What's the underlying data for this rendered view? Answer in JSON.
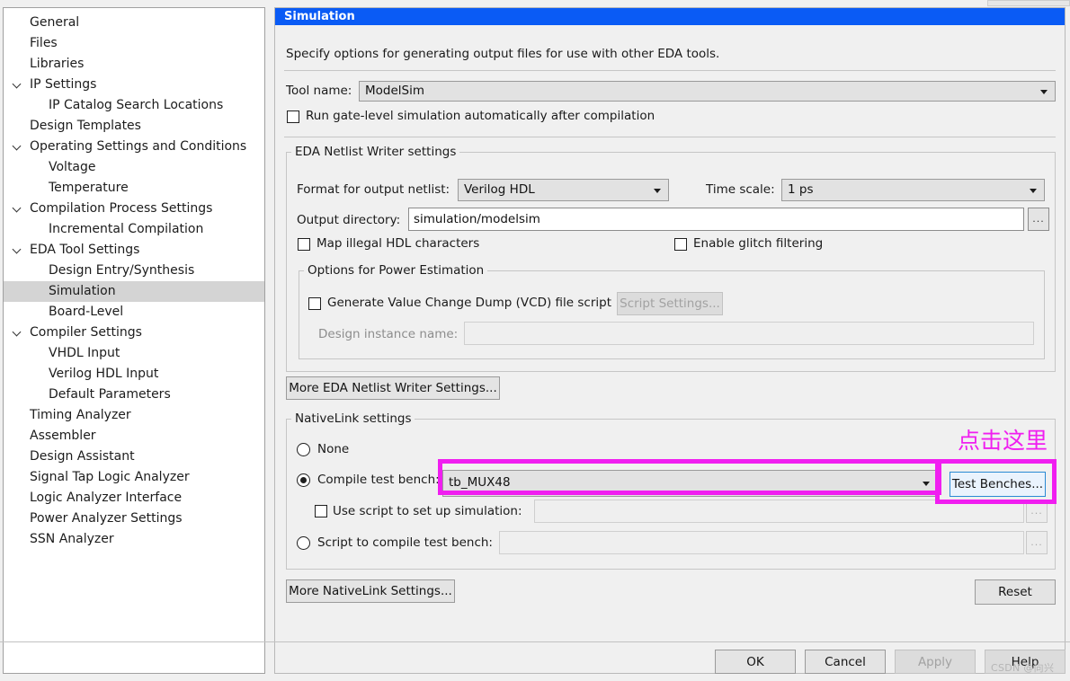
{
  "window": {
    "panel_title": "Simulation",
    "description": "Specify options for generating output files for use with other EDA tools."
  },
  "sidebar": {
    "items": [
      {
        "label": "General",
        "indent": 0,
        "expander": false,
        "selected": false
      },
      {
        "label": "Files",
        "indent": 0,
        "expander": false,
        "selected": false
      },
      {
        "label": "Libraries",
        "indent": 0,
        "expander": false,
        "selected": false
      },
      {
        "label": "IP Settings",
        "indent": 0,
        "expander": true,
        "selected": false
      },
      {
        "label": "IP Catalog Search Locations",
        "indent": 1,
        "expander": false,
        "selected": false
      },
      {
        "label": "Design Templates",
        "indent": 0,
        "expander": false,
        "selected": false
      },
      {
        "label": "Operating Settings and Conditions",
        "indent": 0,
        "expander": true,
        "selected": false
      },
      {
        "label": "Voltage",
        "indent": 1,
        "expander": false,
        "selected": false
      },
      {
        "label": "Temperature",
        "indent": 1,
        "expander": false,
        "selected": false
      },
      {
        "label": "Compilation Process Settings",
        "indent": 0,
        "expander": true,
        "selected": false
      },
      {
        "label": "Incremental Compilation",
        "indent": 1,
        "expander": false,
        "selected": false
      },
      {
        "label": "EDA Tool Settings",
        "indent": 0,
        "expander": true,
        "selected": false
      },
      {
        "label": "Design Entry/Synthesis",
        "indent": 1,
        "expander": false,
        "selected": false
      },
      {
        "label": "Simulation",
        "indent": 1,
        "expander": false,
        "selected": true
      },
      {
        "label": "Board-Level",
        "indent": 1,
        "expander": false,
        "selected": false
      },
      {
        "label": "Compiler Settings",
        "indent": 0,
        "expander": true,
        "selected": false
      },
      {
        "label": "VHDL Input",
        "indent": 1,
        "expander": false,
        "selected": false
      },
      {
        "label": "Verilog HDL Input",
        "indent": 1,
        "expander": false,
        "selected": false
      },
      {
        "label": "Default Parameters",
        "indent": 1,
        "expander": false,
        "selected": false
      },
      {
        "label": "Timing Analyzer",
        "indent": 0,
        "expander": false,
        "selected": false
      },
      {
        "label": "Assembler",
        "indent": 0,
        "expander": false,
        "selected": false
      },
      {
        "label": "Design Assistant",
        "indent": 0,
        "expander": false,
        "selected": false
      },
      {
        "label": "Signal Tap Logic Analyzer",
        "indent": 0,
        "expander": false,
        "selected": false
      },
      {
        "label": "Logic Analyzer Interface",
        "indent": 0,
        "expander": false,
        "selected": false
      },
      {
        "label": "Power Analyzer Settings",
        "indent": 0,
        "expander": false,
        "selected": false
      },
      {
        "label": "SSN Analyzer",
        "indent": 0,
        "expander": false,
        "selected": false
      }
    ]
  },
  "tool": {
    "label": "Tool name:",
    "value": "ModelSim"
  },
  "run_gate_level": {
    "label": "Run gate-level simulation automatically after compilation",
    "checked": false
  },
  "netlist": {
    "group_title": "EDA Netlist Writer settings",
    "format_label": "Format for output netlist:",
    "format_value": "Verilog HDL",
    "timescale_label": "Time scale:",
    "timescale_value": "1 ps",
    "output_dir_label": "Output directory:",
    "output_dir_value": "simulation/modelsim",
    "browse_label": "...",
    "map_illegal_label": "Map illegal HDL characters",
    "map_illegal_checked": false,
    "glitch_label": "Enable glitch filtering",
    "glitch_checked": false
  },
  "power": {
    "group_title": "Options for Power Estimation",
    "vcd_label": "Generate Value Change Dump (VCD) file script",
    "vcd_checked": false,
    "script_settings_label": "Script Settings...",
    "instance_label": "Design instance name:",
    "instance_value": ""
  },
  "more_netlist_btn": "More EDA Netlist Writer Settings...",
  "nativelink": {
    "group_title": "NativeLink settings",
    "none_label": "None",
    "none_selected": false,
    "compile_tb_label": "Compile test bench:",
    "compile_tb_selected": true,
    "compile_tb_value": "tb_MUX48",
    "test_benches_btn": "Test Benches...",
    "use_script_label": "Use script to set up simulation:",
    "use_script_checked": false,
    "use_script_value": "",
    "script_compile_label": "Script to compile test bench:",
    "script_compile_selected": false,
    "script_compile_value": "",
    "browse_label": "..."
  },
  "more_nativelink_btn": "More NativeLink Settings...",
  "reset_btn": "Reset",
  "footer": {
    "ok": "OK",
    "cancel": "Cancel",
    "apply": "Apply",
    "help": "Help",
    "apply_disabled": true,
    "help_disabled": true
  },
  "annotation": {
    "text": "点击这里",
    "color": "#f01ef0"
  },
  "watermark": "CSDN @向兴"
}
